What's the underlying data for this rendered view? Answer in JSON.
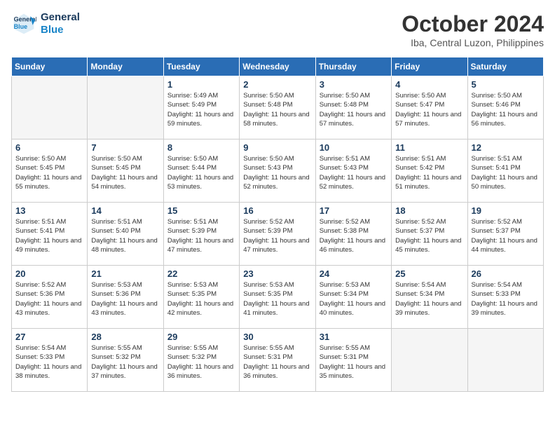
{
  "header": {
    "logo_line1": "General",
    "logo_line2": "Blue",
    "month_title": "October 2024",
    "subtitle": "Iba, Central Luzon, Philippines"
  },
  "days_of_week": [
    "Sunday",
    "Monday",
    "Tuesday",
    "Wednesday",
    "Thursday",
    "Friday",
    "Saturday"
  ],
  "weeks": [
    [
      {
        "day": "",
        "empty": true
      },
      {
        "day": "",
        "empty": true
      },
      {
        "day": "1",
        "sunrise": "Sunrise: 5:49 AM",
        "sunset": "Sunset: 5:49 PM",
        "daylight": "Daylight: 11 hours and 59 minutes."
      },
      {
        "day": "2",
        "sunrise": "Sunrise: 5:50 AM",
        "sunset": "Sunset: 5:48 PM",
        "daylight": "Daylight: 11 hours and 58 minutes."
      },
      {
        "day": "3",
        "sunrise": "Sunrise: 5:50 AM",
        "sunset": "Sunset: 5:48 PM",
        "daylight": "Daylight: 11 hours and 57 minutes."
      },
      {
        "day": "4",
        "sunrise": "Sunrise: 5:50 AM",
        "sunset": "Sunset: 5:47 PM",
        "daylight": "Daylight: 11 hours and 57 minutes."
      },
      {
        "day": "5",
        "sunrise": "Sunrise: 5:50 AM",
        "sunset": "Sunset: 5:46 PM",
        "daylight": "Daylight: 11 hours and 56 minutes."
      }
    ],
    [
      {
        "day": "6",
        "sunrise": "Sunrise: 5:50 AM",
        "sunset": "Sunset: 5:45 PM",
        "daylight": "Daylight: 11 hours and 55 minutes."
      },
      {
        "day": "7",
        "sunrise": "Sunrise: 5:50 AM",
        "sunset": "Sunset: 5:45 PM",
        "daylight": "Daylight: 11 hours and 54 minutes."
      },
      {
        "day": "8",
        "sunrise": "Sunrise: 5:50 AM",
        "sunset": "Sunset: 5:44 PM",
        "daylight": "Daylight: 11 hours and 53 minutes."
      },
      {
        "day": "9",
        "sunrise": "Sunrise: 5:50 AM",
        "sunset": "Sunset: 5:43 PM",
        "daylight": "Daylight: 11 hours and 52 minutes."
      },
      {
        "day": "10",
        "sunrise": "Sunrise: 5:51 AM",
        "sunset": "Sunset: 5:43 PM",
        "daylight": "Daylight: 11 hours and 52 minutes."
      },
      {
        "day": "11",
        "sunrise": "Sunrise: 5:51 AM",
        "sunset": "Sunset: 5:42 PM",
        "daylight": "Daylight: 11 hours and 51 minutes."
      },
      {
        "day": "12",
        "sunrise": "Sunrise: 5:51 AM",
        "sunset": "Sunset: 5:41 PM",
        "daylight": "Daylight: 11 hours and 50 minutes."
      }
    ],
    [
      {
        "day": "13",
        "sunrise": "Sunrise: 5:51 AM",
        "sunset": "Sunset: 5:41 PM",
        "daylight": "Daylight: 11 hours and 49 minutes."
      },
      {
        "day": "14",
        "sunrise": "Sunrise: 5:51 AM",
        "sunset": "Sunset: 5:40 PM",
        "daylight": "Daylight: 11 hours and 48 minutes."
      },
      {
        "day": "15",
        "sunrise": "Sunrise: 5:51 AM",
        "sunset": "Sunset: 5:39 PM",
        "daylight": "Daylight: 11 hours and 47 minutes."
      },
      {
        "day": "16",
        "sunrise": "Sunrise: 5:52 AM",
        "sunset": "Sunset: 5:39 PM",
        "daylight": "Daylight: 11 hours and 47 minutes."
      },
      {
        "day": "17",
        "sunrise": "Sunrise: 5:52 AM",
        "sunset": "Sunset: 5:38 PM",
        "daylight": "Daylight: 11 hours and 46 minutes."
      },
      {
        "day": "18",
        "sunrise": "Sunrise: 5:52 AM",
        "sunset": "Sunset: 5:37 PM",
        "daylight": "Daylight: 11 hours and 45 minutes."
      },
      {
        "day": "19",
        "sunrise": "Sunrise: 5:52 AM",
        "sunset": "Sunset: 5:37 PM",
        "daylight": "Daylight: 11 hours and 44 minutes."
      }
    ],
    [
      {
        "day": "20",
        "sunrise": "Sunrise: 5:52 AM",
        "sunset": "Sunset: 5:36 PM",
        "daylight": "Daylight: 11 hours and 43 minutes."
      },
      {
        "day": "21",
        "sunrise": "Sunrise: 5:53 AM",
        "sunset": "Sunset: 5:36 PM",
        "daylight": "Daylight: 11 hours and 43 minutes."
      },
      {
        "day": "22",
        "sunrise": "Sunrise: 5:53 AM",
        "sunset": "Sunset: 5:35 PM",
        "daylight": "Daylight: 11 hours and 42 minutes."
      },
      {
        "day": "23",
        "sunrise": "Sunrise: 5:53 AM",
        "sunset": "Sunset: 5:35 PM",
        "daylight": "Daylight: 11 hours and 41 minutes."
      },
      {
        "day": "24",
        "sunrise": "Sunrise: 5:53 AM",
        "sunset": "Sunset: 5:34 PM",
        "daylight": "Daylight: 11 hours and 40 minutes."
      },
      {
        "day": "25",
        "sunrise": "Sunrise: 5:54 AM",
        "sunset": "Sunset: 5:34 PM",
        "daylight": "Daylight: 11 hours and 39 minutes."
      },
      {
        "day": "26",
        "sunrise": "Sunrise: 5:54 AM",
        "sunset": "Sunset: 5:33 PM",
        "daylight": "Daylight: 11 hours and 39 minutes."
      }
    ],
    [
      {
        "day": "27",
        "sunrise": "Sunrise: 5:54 AM",
        "sunset": "Sunset: 5:33 PM",
        "daylight": "Daylight: 11 hours and 38 minutes."
      },
      {
        "day": "28",
        "sunrise": "Sunrise: 5:55 AM",
        "sunset": "Sunset: 5:32 PM",
        "daylight": "Daylight: 11 hours and 37 minutes."
      },
      {
        "day": "29",
        "sunrise": "Sunrise: 5:55 AM",
        "sunset": "Sunset: 5:32 PM",
        "daylight": "Daylight: 11 hours and 36 minutes."
      },
      {
        "day": "30",
        "sunrise": "Sunrise: 5:55 AM",
        "sunset": "Sunset: 5:31 PM",
        "daylight": "Daylight: 11 hours and 36 minutes."
      },
      {
        "day": "31",
        "sunrise": "Sunrise: 5:55 AM",
        "sunset": "Sunset: 5:31 PM",
        "daylight": "Daylight: 11 hours and 35 minutes."
      },
      {
        "day": "",
        "empty": true
      },
      {
        "day": "",
        "empty": true
      }
    ]
  ]
}
